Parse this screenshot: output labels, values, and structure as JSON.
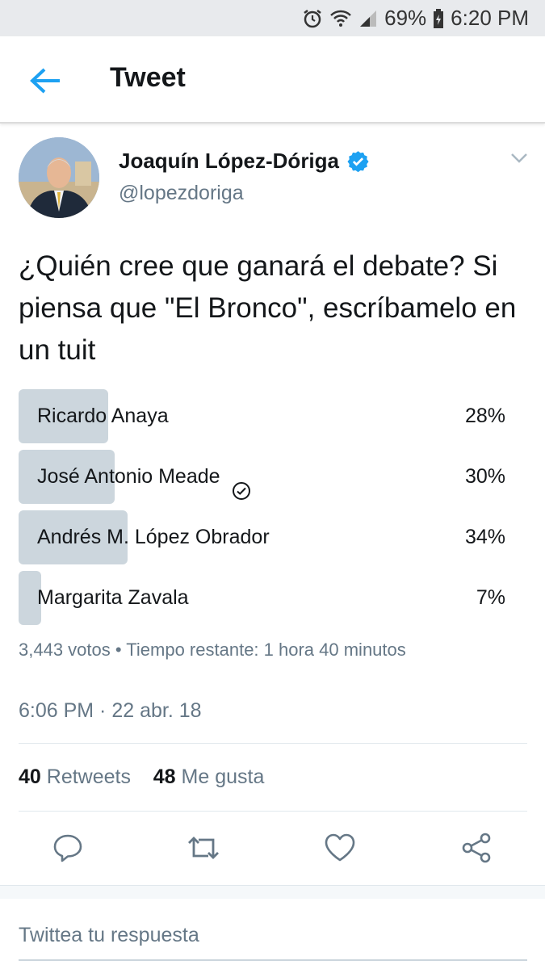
{
  "status_bar": {
    "battery": "69%",
    "time": "6:20 PM"
  },
  "app_bar": {
    "title": "Tweet"
  },
  "tweet": {
    "author_name": "Joaquín López-Dóriga",
    "handle": "@lopezdoriga",
    "text": "¿Quién cree que ganará el debate? Si piensa que \"El Bronco\", escríbamelo en un tuit",
    "poll": {
      "options": [
        {
          "label": "Ricardo Anaya",
          "percent_text": "28%",
          "percent": 28,
          "voted": false
        },
        {
          "label": "José Antonio Meade",
          "percent_text": "30%",
          "percent": 30,
          "voted": true
        },
        {
          "label": "Andrés M. López Obrador",
          "percent_text": "34%",
          "percent": 34,
          "voted": false
        },
        {
          "label": "Margarita Zavala",
          "percent_text": "7%",
          "percent": 7,
          "voted": false
        }
      ],
      "meta": "3,443 votos • Tiempo restante: 1 hora 40 minutos"
    },
    "timestamp": "6:06 PM · 22 abr. 18",
    "retweets_count": "40",
    "retweets_label": "Retweets",
    "likes_count": "48",
    "likes_label": "Me gusta"
  },
  "reply": {
    "placeholder": "Twittea tu respuesta"
  },
  "colors": {
    "accent": "#1da1f2",
    "poll_fill": "#ccd6dd",
    "secondary_text": "#657786"
  }
}
